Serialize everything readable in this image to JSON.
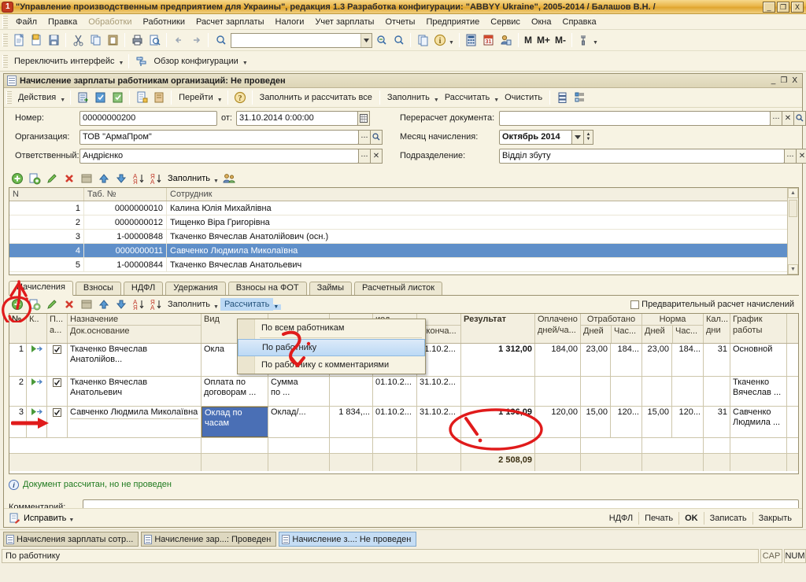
{
  "window": {
    "title": "\"Управление производственным предприятием для Украины\", редакция 1.3 Разработка конфигурации: \"ABBYY Ukraine\", 2005-2014 / Балашов В.Н. /",
    "min": "_",
    "restore": "❐",
    "close": "X"
  },
  "menubar": {
    "items": [
      {
        "label": "Файл",
        "dim": false
      },
      {
        "label": "Правка",
        "dim": false
      },
      {
        "label": "Обработки",
        "dim": true
      },
      {
        "label": "Работники",
        "dim": false
      },
      {
        "label": "Расчет зарплаты",
        "dim": false
      },
      {
        "label": "Налоги",
        "dim": false
      },
      {
        "label": "Учет зарплаты",
        "dim": false
      },
      {
        "label": "Отчеты",
        "dim": false
      },
      {
        "label": "Предприятие",
        "dim": false
      },
      {
        "label": "Сервис",
        "dim": false
      },
      {
        "label": "Окна",
        "dim": false
      },
      {
        "label": "Справка",
        "dim": false
      }
    ]
  },
  "toolbar_main": {
    "search_value": "",
    "m_buttons": [
      "M",
      "M+",
      "M-"
    ],
    "icons": [
      "new-document-icon",
      "open-folder-icon",
      "save-icon",
      "cut-icon",
      "copy-icon",
      "paste-icon",
      "print-icon",
      "print-preview-icon",
      "undo-icon",
      "redo-icon",
      "find-icon",
      "find-next-icon",
      "find-prev-icon",
      "copy-link-icon",
      "info-icon",
      "calculator-icon",
      "calendar-icon",
      "user-icon",
      "settings-icon"
    ]
  },
  "toolbar_secondary": {
    "switch_interface": "Переключить интерфейс",
    "config_overview": "Обзор конфигурации"
  },
  "document": {
    "title": "Начисление зарплаты работникам организаций: Не проведен",
    "win_min": "_",
    "win_restore": "❐",
    "win_close": "X",
    "actions_button": "Действия",
    "goto_button": "Перейти",
    "fill_and_calc_all": "Заполнить и рассчитать все",
    "fill_button": "Заполнить",
    "calc_button": "Рассчитать",
    "clear_button": "Очистить"
  },
  "form": {
    "number_label": "Номер:",
    "number_value": "00000000200",
    "date_label": "от:",
    "date_value": "31.10.2014  0:00:00",
    "org_label": "Организация:",
    "org_value": "ТОВ \"АрмаПром\"",
    "responsible_label": "Ответственный:",
    "responsible_value": "Андрієнко",
    "recalc_label": "Перерасчет документа:",
    "recalc_value": "",
    "month_label": "Месяц начисления:",
    "month_value": "Октябрь 2014",
    "subdivision_label": "Подразделение:",
    "subdivision_value": "Відділ збуту",
    "dots_btn": "...",
    "clear_btn": "✕",
    "search_btn": "search-icon",
    "calendar_btn": "calendar-icon"
  },
  "employee_grid": {
    "toolbar_fill": "Заполнить",
    "columns": [
      "N",
      "Таб. №",
      "Сотрудник"
    ],
    "rows": [
      {
        "n": "1",
        "tab": "0000000010",
        "name": "Калина Юлія Михайлівна",
        "selected": false
      },
      {
        "n": "2",
        "tab": "0000000012",
        "name": "Тищенко Віра Григорівна",
        "selected": false
      },
      {
        "n": "3",
        "tab": "1-00000848",
        "name": "Ткаченко Вячеслав Анатолійович (осн.)",
        "selected": false
      },
      {
        "n": "4",
        "tab": "0000000011",
        "name": "Савченко Людмила Миколаївна",
        "selected": true
      },
      {
        "n": "5",
        "tab": "1-00000844",
        "name": "Ткаченко Вячеслав Анатольевич",
        "selected": false
      }
    ]
  },
  "tabs": [
    {
      "label": "Начисления",
      "active": true
    },
    {
      "label": "Взносы",
      "active": false
    },
    {
      "label": "НДФЛ",
      "active": false
    },
    {
      "label": "Удержания",
      "active": false
    },
    {
      "label": "Взносы на ФОТ",
      "active": false
    },
    {
      "label": "Займы",
      "active": false
    },
    {
      "label": "Расчетный листок",
      "active": false
    }
  ],
  "lower_toolbar": {
    "fill_button": "Заполнить",
    "calc_button": "Рассчитать",
    "preliminary_checkbox_label": "Предварительный расчет начислений",
    "preliminary_checked": false
  },
  "calc_menu": {
    "items": [
      {
        "label": "По всем работникам",
        "selected": false
      },
      {
        "label": "По работнику",
        "selected": true
      },
      {
        "label": "По работнику с комментариями",
        "selected": false
      }
    ]
  },
  "detail_grid": {
    "headers": {
      "num": "№",
      "k": "К..",
      "p_line1": "П...",
      "p_line2": "а...",
      "naz_line1": "Назначение",
      "naz_line2": "Док.основание",
      "vid": "Вид",
      "pokazatel": "",
      "znachenie": "",
      "period": "иод",
      "period_sub": "Оконча...",
      "result": "Результат",
      "oplacheno_line1": "Оплачено",
      "oplacheno_line2": "дней/ча...",
      "otrabotano": "Отработано",
      "otrabotano_days": "Дней",
      "otrabotano_hours": "Час...",
      "norma": "Норма",
      "norma_days": "Дней",
      "norma_hours": "Час...",
      "kal_line1": "Кал...",
      "kal_line2": "дни",
      "grafik_line1": "График",
      "grafik_line2": "работы"
    },
    "rows": [
      {
        "num": "1",
        "checked": true,
        "naz": "Ткаченко Вячеслав Анатолійов...",
        "naz2": "",
        "vid": "Окла",
        "vid2": "",
        "pok": "",
        "pok2": "",
        "zn": "",
        "nac": "",
        "okon": "31.10.2...",
        "res": "1 312,00",
        "opl": "184,00",
        "otd": "23,00",
        "oth": "184...",
        "nd": "23,00",
        "nh": "184...",
        "kal": "31",
        "graf": "Основной",
        "graf2": ""
      },
      {
        "num": "2",
        "checked": true,
        "naz": "Ткаченко Вячеслав Анатольевич",
        "naz2": "",
        "vid": "Оплата по",
        "vid2": "договорам ...",
        "pok": "Сумма",
        "pok2": "по ...",
        "zn": "",
        "nac": "01.10.2...",
        "okon": "31.10.2...",
        "res": "",
        "opl": "",
        "otd": "",
        "oth": "",
        "nd": "",
        "nh": "",
        "kal": "",
        "graf": "Ткаченко",
        "graf2": "Вячеслав ..."
      },
      {
        "num": "3",
        "checked": true,
        "naz": "Савченко Людмила Миколаївна",
        "naz2": "",
        "vid": "Оклад по часам",
        "vid2": "",
        "vid_selected": true,
        "pok": "Оклад/...",
        "pok2": "",
        "zn": "1 834,...",
        "nac": "01.10.2...",
        "okon": "31.10.2...",
        "res": "1 196,09",
        "opl": "120,00",
        "otd": "15,00",
        "oth": "120...",
        "nd": "15,00",
        "nh": "120...",
        "kal": "31",
        "graf": "Савченко",
        "graf2": "Людмила ..."
      }
    ],
    "total": "2 508,09"
  },
  "status": {
    "info_text": "Документ рассчитан, но не проведен",
    "comment_label": "Комментарий:",
    "comment_value": ""
  },
  "doc_footer": {
    "fix_button": "Исправить",
    "buttons": [
      "НДФЛ",
      "Печать",
      "OK",
      "Записать",
      "Закрыть"
    ]
  },
  "taskbar": {
    "items": [
      {
        "label": "Начисления зарплаты сотр...",
        "active": false
      },
      {
        "label": "Начисление зар...: Проведен",
        "active": false
      },
      {
        "label": "Начисление з...: Не проведен",
        "active": true
      }
    ]
  },
  "statusbar": {
    "text": "По работнику",
    "cap": "CAP",
    "num": "NUM"
  },
  "colors": {
    "accent": "#4a6fb5",
    "selection": "#5f8fc9",
    "annotation": "#e01b1b",
    "success_text": "#1f7a1f"
  }
}
